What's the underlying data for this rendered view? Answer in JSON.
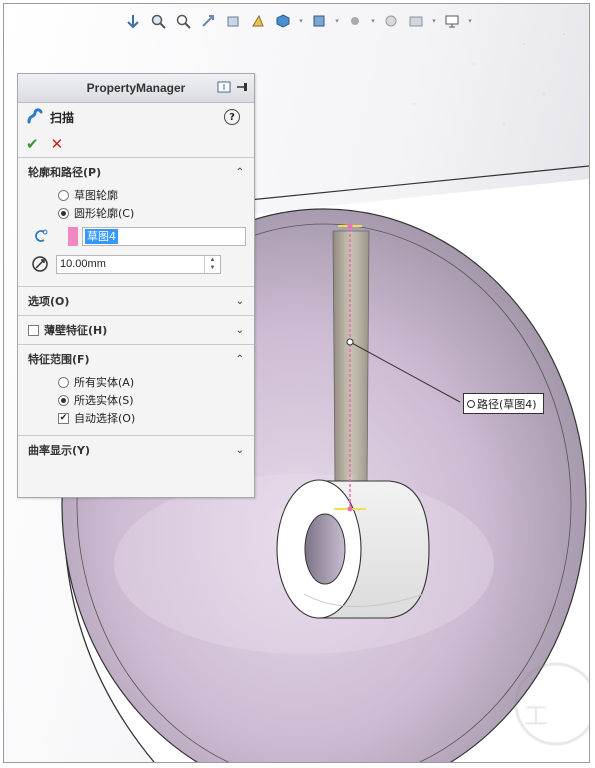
{
  "toolbar": {
    "icons": [
      "view-orientation-icon",
      "zoom-to-fit-icon",
      "zoom-area-icon",
      "previous-view-icon",
      "section-view-icon",
      "dynamic-annotation-icon",
      "view-orientation-cube-icon",
      "display-style-icon",
      "hide-show-icon",
      "edit-appearance-icon",
      "apply-scene-icon",
      "view-settings-icon",
      "monitor-icon"
    ]
  },
  "property_manager": {
    "title": "PropertyManager",
    "feature_name": "扫描",
    "help_label": "?",
    "sections": {
      "profile_path": {
        "label": "轮廓和路径(P)",
        "options": [
          {
            "label": "草图轮廓",
            "selected": false
          },
          {
            "label": "圆形轮廓(C)",
            "selected": true
          }
        ],
        "path_selection": "草图4",
        "diameter": "10.00mm"
      },
      "options": {
        "label": "选项(O)"
      },
      "thin_feature": {
        "label": "薄壁特征(H)",
        "checked": false
      },
      "feature_scope": {
        "label": "特征范围(F)",
        "options": [
          {
            "label": "所有实体(A)",
            "selected": false
          },
          {
            "label": "所选实体(S)",
            "selected": true
          }
        ],
        "auto_select": {
          "label": "自动选择(O)",
          "checked": true
        }
      },
      "curvature_display": {
        "label": "曲率显示(Y)"
      }
    }
  },
  "callout": {
    "label": "路径(草图4)"
  },
  "colors": {
    "accent": "#3399ff",
    "pink": "#f188c1",
    "ok": "#2e9a2e",
    "cancel": "#cc2222"
  }
}
